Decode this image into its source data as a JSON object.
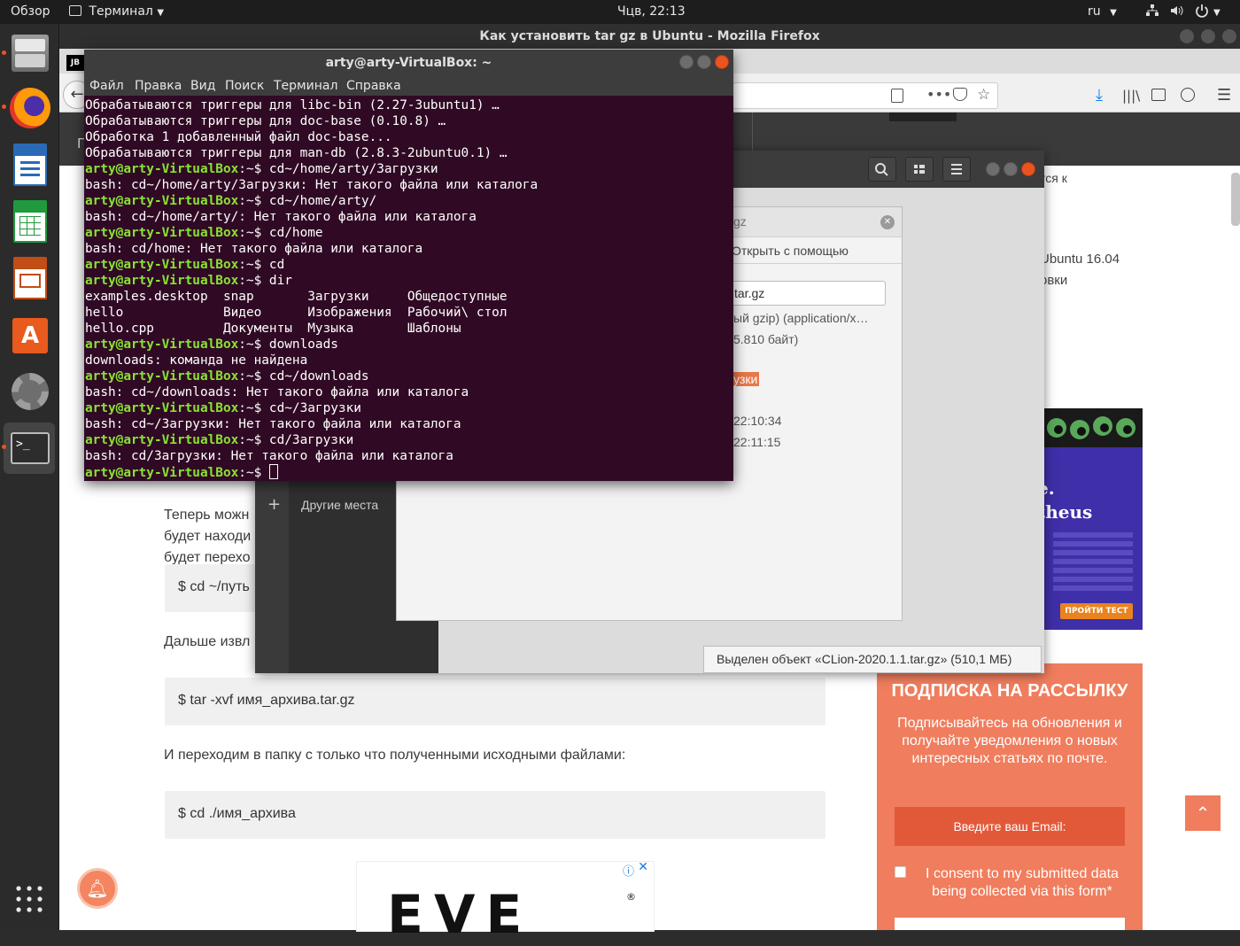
{
  "topbar": {
    "activities": "Обзор",
    "app_menu": "Терминал",
    "clock": "Чцв, 22:13",
    "lang": "ru"
  },
  "firefox": {
    "window_title": "Как установить tar gz в Ubuntu - Mozilla Firefox",
    "article": {
      "para1_lines": [
        "Теперь можн",
        "будет находи",
        "будет перехо"
      ],
      "code1": "$  cd ~/путь",
      "para2": "Дальше извл",
      "code2": "$  tar -xvf имя_архива.tar.gz",
      "para3": "И переходим в папку с только что полученными исходными файлами:",
      "code3": "$  cd ./имя_архива"
    },
    "sidebar_text": {
      "line1": "тся к",
      "line2": "Ubuntu 16.04",
      "line3": "овки"
    },
    "ad": {
      "text1": "e.",
      "text2": "theus",
      "button": "ПРОЙТИ ТЕСТ"
    },
    "ad_bottom": {
      "logo": "EVE"
    },
    "subscribe": {
      "title": "ПОДПИСКА НА РАССЫЛКУ",
      "description": "Подписывайтесь на обновления и получайте уведомления о новых интересных статьях по почте.",
      "email_placeholder": "Введите ваш Email:",
      "consent": "I consent to my submitted data being collected via this form*"
    },
    "partial_left": "Г"
  },
  "nautilus": {
    "sidebar_other": "Другие места",
    "statusbar": "Выделен объект «CLion-2020.1.1.tar.gz» (510,1 МБ)",
    "props": {
      "title_suffix": "gz",
      "open_with_tab": "Открыть с помощью",
      "name_value": "tar.gz",
      "type_value": "ый gzip) (application/x…",
      "size_value": "5.810 байт)",
      "folder_value": "узки",
      "accessed": "22:10:34",
      "modified": "22:11:15"
    }
  },
  "terminal": {
    "title": "arty@arty-VirtualBox: ~",
    "menu": [
      "Файл",
      "Правка",
      "Вид",
      "Поиск",
      "Терминал",
      "Справка"
    ],
    "prompt": "arty@arty-VirtualBox",
    "lines": [
      {
        "type": "out",
        "text": "Обрабатываются триггеры для libc-bin (2.27-3ubuntu1) …"
      },
      {
        "type": "out",
        "text": "Обрабатываются триггеры для doc-base (0.10.8) …"
      },
      {
        "type": "out",
        "text": "Обработка 1 добавленный файл doc-base..."
      },
      {
        "type": "out",
        "text": "Обрабатываются триггеры для man-db (2.8.3-2ubuntu0.1) …"
      },
      {
        "type": "cmd",
        "text": "cd~/home/arty/Загрузки"
      },
      {
        "type": "out",
        "text": "bash: cd~/home/arty/Загрузки: Нет такого файла или каталога"
      },
      {
        "type": "cmd",
        "text": "cd~/home/arty/"
      },
      {
        "type": "out",
        "text": "bash: cd~/home/arty/: Нет такого файла или каталога"
      },
      {
        "type": "cmd",
        "text": "cd/home"
      },
      {
        "type": "out",
        "text": "bash: cd/home: Нет такого файла или каталога"
      },
      {
        "type": "cmd",
        "text": "cd"
      },
      {
        "type": "cmd",
        "text": "dir"
      },
      {
        "type": "out",
        "text": "examples.desktop  snap       Загрузки     Общедоступные"
      },
      {
        "type": "out",
        "text": "hello             Видео      Изображения  Рабочий\\ стол"
      },
      {
        "type": "out",
        "text": "hello.cpp         Документы  Музыка       Шаблоны"
      },
      {
        "type": "cmd",
        "text": "downloads"
      },
      {
        "type": "out",
        "text": "downloads: команда не найдена"
      },
      {
        "type": "cmd",
        "text": "cd~/downloads"
      },
      {
        "type": "out",
        "text": "bash: cd~/downloads: Нет такого файла или каталога"
      },
      {
        "type": "cmd",
        "text": "cd~/Загрузки"
      },
      {
        "type": "out",
        "text": "bash: cd~/Загрузки: Нет такого файла или каталога"
      },
      {
        "type": "cmd",
        "text": "cd/Загрузки"
      },
      {
        "type": "out",
        "text": "bash: cd/Загрузки: Нет такого файла или каталога"
      },
      {
        "type": "current",
        "text": ""
      }
    ]
  },
  "colors": {
    "terminal_bg": "#300a24",
    "prompt_green": "#8ae234",
    "ubuntu_orange": "#e95420",
    "subscribe_bg": "#f07d5d"
  }
}
